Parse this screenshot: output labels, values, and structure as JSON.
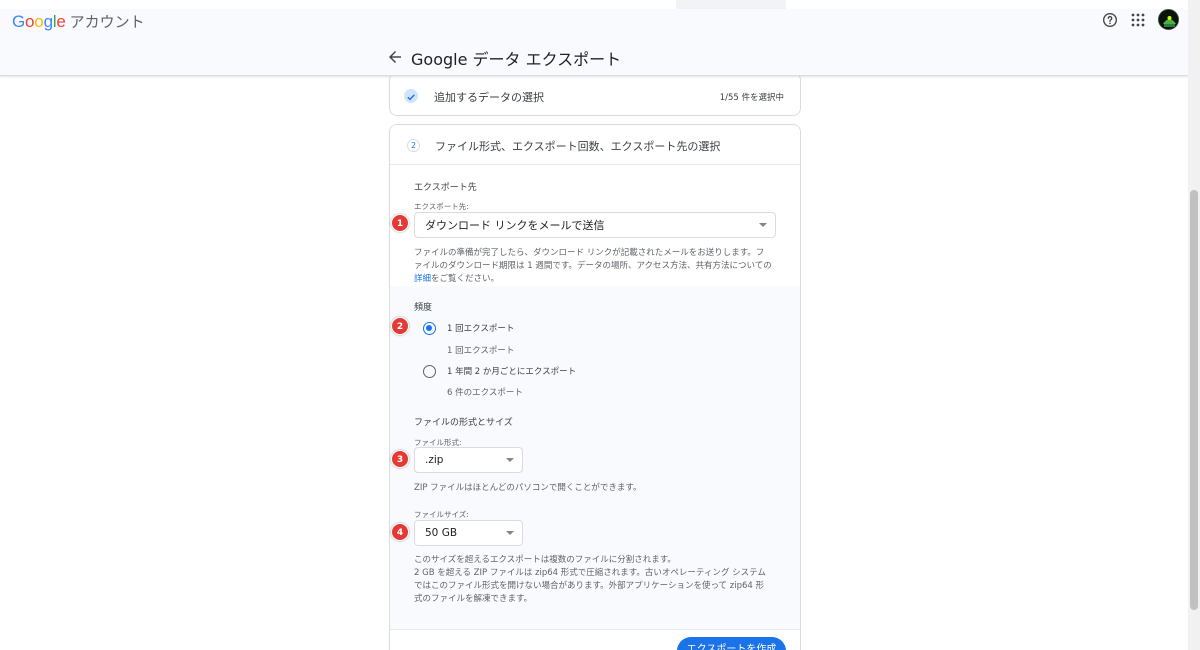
{
  "header": {
    "logo_text": "Google",
    "account_label": "アカウント",
    "page_title": "Google データ エクスポート"
  },
  "step1": {
    "title": "追加するデータの選択",
    "selected_count": "1/55 件を選択中"
  },
  "step2": {
    "number": "2",
    "title": "ファイル形式、エクスポート回数、エクスポート先の選択",
    "destination": {
      "section_title": "エクスポート先",
      "field_label": "エクスポート先:",
      "selected": "ダウンロード リンクをメールで送信",
      "desc_line1": "ファイルの準備が完了したら、ダウンロード リンクが記載されたメールをお送りします。フ",
      "desc_line2": "ァイルのダウンロード期限は 1 週間です。データの場所、アクセス方法、共有方法についての",
      "desc_link": "詳細",
      "desc_tail": "をご覧ください。"
    },
    "frequency": {
      "section_title": "頻度",
      "options": [
        {
          "label": "1 回エクスポート",
          "sub": "1 回エクスポート",
          "selected": true
        },
        {
          "label": "1 年間 2 か月ごとにエクスポート",
          "sub": "6 件のエクスポート",
          "selected": false
        }
      ]
    },
    "file_format": {
      "section_title": "ファイルの形式とサイズ",
      "field_label": "ファイル形式:",
      "selected": ".zip",
      "desc": "ZIP ファイルはほとんどのパソコンで開くことができます。"
    },
    "file_size": {
      "field_label": "ファイルサイズ:",
      "selected": "50 GB",
      "desc_lines": [
        "このサイズを超えるエクスポートは複数のファイルに分割されます。",
        "2 GB を超える ZIP ファイルは zip64 形式で圧縮されます。古いオペレーティング システム",
        "ではこのファイル形式を開けない場合があります。外部アプリケーションを使って zip64 形",
        "式のファイルを解凍できます。"
      ]
    },
    "create_button": "エクスポートを作成"
  },
  "annotations": [
    "1",
    "2",
    "3",
    "4"
  ],
  "colors": {
    "accent": "#1a73e8",
    "badge": "#e53935",
    "google_blue": "#4285f4",
    "google_red": "#ea4335",
    "google_yellow": "#fbbc05",
    "google_green": "#34a853"
  },
  "icons": [
    "back-arrow-icon",
    "help-icon",
    "apps-grid-icon",
    "check-icon"
  ]
}
